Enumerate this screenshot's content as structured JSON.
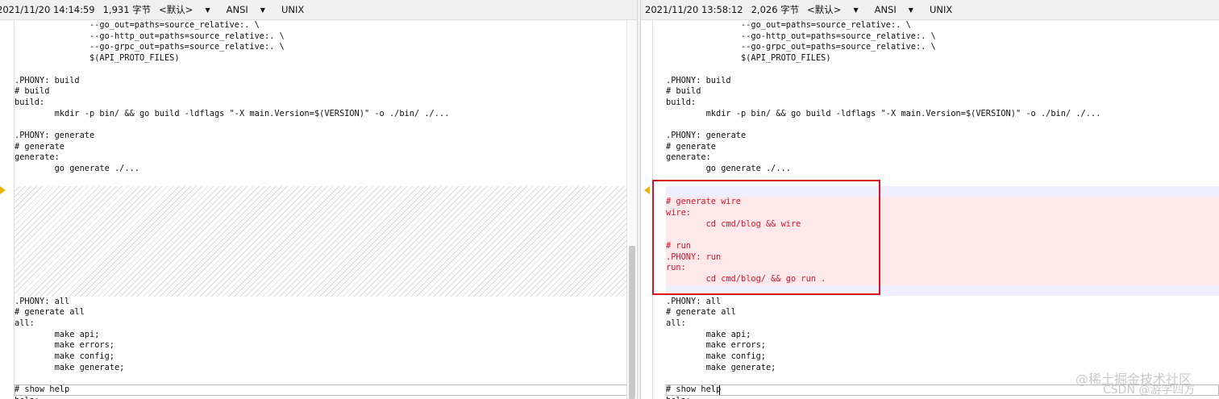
{
  "left": {
    "status": {
      "datetime": "2021/11/20 14:14:59",
      "chars": "1,931 字节",
      "encoding_mode": "<默认>",
      "charset": "ANSI",
      "eol": "UNIX"
    },
    "lines": [
      {
        "t": "               --go_out=paths=source_relative:. \\"
      },
      {
        "t": "               --go-http_out=paths=source_relative:. \\"
      },
      {
        "t": "               --go-grpc_out=paths=source_relative:. \\"
      },
      {
        "t": "               $(API_PROTO_FILES)"
      },
      {
        "t": ""
      },
      {
        "t": ".PHONY: build"
      },
      {
        "t": "# build"
      },
      {
        "t": "build:"
      },
      {
        "t": "        mkdir -p bin/ && go build -ldflags \"-X main.Version=$(VERSION)\" -o ./bin/ ./..."
      },
      {
        "t": ""
      },
      {
        "t": ".PHONY: generate"
      },
      {
        "t": "# generate"
      },
      {
        "t": "generate:"
      },
      {
        "t": "        go generate ./..."
      },
      {
        "t": ""
      },
      {
        "t": "",
        "kind": "hatch"
      },
      {
        "t": "",
        "kind": "hatch"
      },
      {
        "t": "",
        "kind": "hatch"
      },
      {
        "t": "",
        "kind": "hatch"
      },
      {
        "t": "",
        "kind": "hatch"
      },
      {
        "t": "",
        "kind": "hatch"
      },
      {
        "t": "",
        "kind": "hatch"
      },
      {
        "t": "",
        "kind": "hatch"
      },
      {
        "t": "",
        "kind": "hatch"
      },
      {
        "t": "",
        "kind": "hatch"
      },
      {
        "t": ".PHONY: all"
      },
      {
        "t": "# generate all"
      },
      {
        "t": "all:"
      },
      {
        "t": "        make api;"
      },
      {
        "t": "        make errors;"
      },
      {
        "t": "        make config;"
      },
      {
        "t": "        make generate;"
      },
      {
        "t": ""
      },
      {
        "t": "# show help",
        "kind": "current"
      },
      {
        "t": "help:"
      }
    ]
  },
  "right": {
    "status": {
      "datetime": "2021/11/20 13:58:12",
      "chars": "2,026 字节",
      "encoding_mode": "<默认>",
      "charset": "ANSI",
      "eol": "UNIX"
    },
    "lines": [
      {
        "t": "               --go_out=paths=source_relative:. \\"
      },
      {
        "t": "               --go-http_out=paths=source_relative:. \\"
      },
      {
        "t": "               --go-grpc_out=paths=source_relative:. \\"
      },
      {
        "t": "               $(API_PROTO_FILES)"
      },
      {
        "t": ""
      },
      {
        "t": ".PHONY: build"
      },
      {
        "t": "# build"
      },
      {
        "t": "build:"
      },
      {
        "t": "        mkdir -p bin/ && go build -ldflags \"-X main.Version=$(VERSION)\" -o ./bin/ ./..."
      },
      {
        "t": ""
      },
      {
        "t": ".PHONY: generate"
      },
      {
        "t": "# generate"
      },
      {
        "t": "generate:"
      },
      {
        "t": "        go generate ./..."
      },
      {
        "t": ""
      },
      {
        "t": "",
        "kind": "sep"
      },
      {
        "t": "# generate wire",
        "kind": "added"
      },
      {
        "t": "wire:",
        "kind": "added"
      },
      {
        "t": "        cd cmd/blog && wire",
        "kind": "added"
      },
      {
        "t": "",
        "kind": "added"
      },
      {
        "t": "# run",
        "kind": "added"
      },
      {
        "t": ".PHONY: run",
        "kind": "added"
      },
      {
        "t": "run:",
        "kind": "added"
      },
      {
        "t": "        cd cmd/blog/ && go run .",
        "kind": "added"
      },
      {
        "t": "",
        "kind": "sep"
      },
      {
        "t": ".PHONY: all"
      },
      {
        "t": "# generate all"
      },
      {
        "t": "all:"
      },
      {
        "t": "        make api;"
      },
      {
        "t": "        make errors;"
      },
      {
        "t": "        make config;"
      },
      {
        "t": "        make generate;"
      },
      {
        "t": ""
      },
      {
        "t": "# show help",
        "kind": "current"
      },
      {
        "t": "help:"
      }
    ]
  },
  "watermark": {
    "line1": "@稀土掘金技术社区",
    "line2": "CSDN @游学四方"
  },
  "colors": {
    "added_text": "#e0142c",
    "added_bg": "#ffe8ea",
    "highlight_box": "#e0141e",
    "diff_marker": "#e8b400"
  }
}
